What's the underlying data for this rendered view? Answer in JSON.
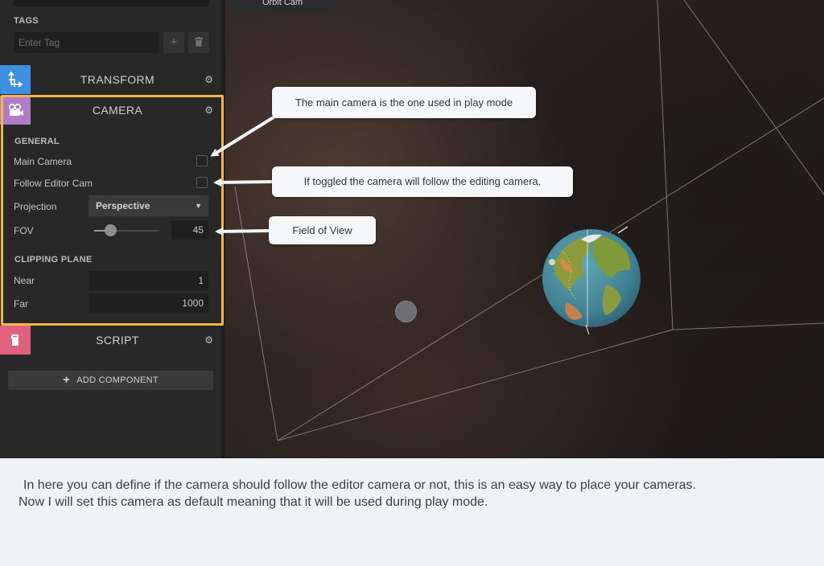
{
  "viewport": {
    "orbit_cam_label": "Orbit Cam"
  },
  "inspector": {
    "tags_heading": "TAGS",
    "tag_placeholder": "Enter Tag",
    "add_tag_icon": "plus-icon",
    "delete_tag_icon": "trash-icon",
    "transform": {
      "title": "TRANSFORM",
      "icon": "transform-axes-icon",
      "color": "#3d8fe0"
    },
    "camera": {
      "title": "CAMERA",
      "icon": "video-camera-icon",
      "color": "#b07cc6",
      "general_heading": "GENERAL",
      "main_camera_label": "Main Camera",
      "main_camera_checked": false,
      "follow_editor_label": "Follow Editor Cam",
      "follow_editor_checked": false,
      "projection_label": "Projection",
      "projection_value": "Perspective",
      "fov_label": "FOV",
      "fov_value": "45",
      "clipping_heading": "CLIPPING PLANE",
      "near_label": "Near",
      "near_value": "1",
      "far_label": "Far",
      "far_value": "1000"
    },
    "script": {
      "title": "SCRIPT",
      "icon": "script-icon",
      "color": "#e0607e"
    },
    "add_component_label": "ADD COMPONENT",
    "highlight_color": "#f0b84a"
  },
  "callouts": {
    "main_camera": "The main camera is the one used in play mode",
    "follow_editor": "If toggled the camera will follow the editing camera.",
    "fov": "Field of View"
  },
  "caption": {
    "line1": "In here you can define if the camera should follow the editor camera or not, this is an easy way to place your cameras.",
    "line2": "Now I will set this camera as default meaning that it will be used during play mode."
  }
}
